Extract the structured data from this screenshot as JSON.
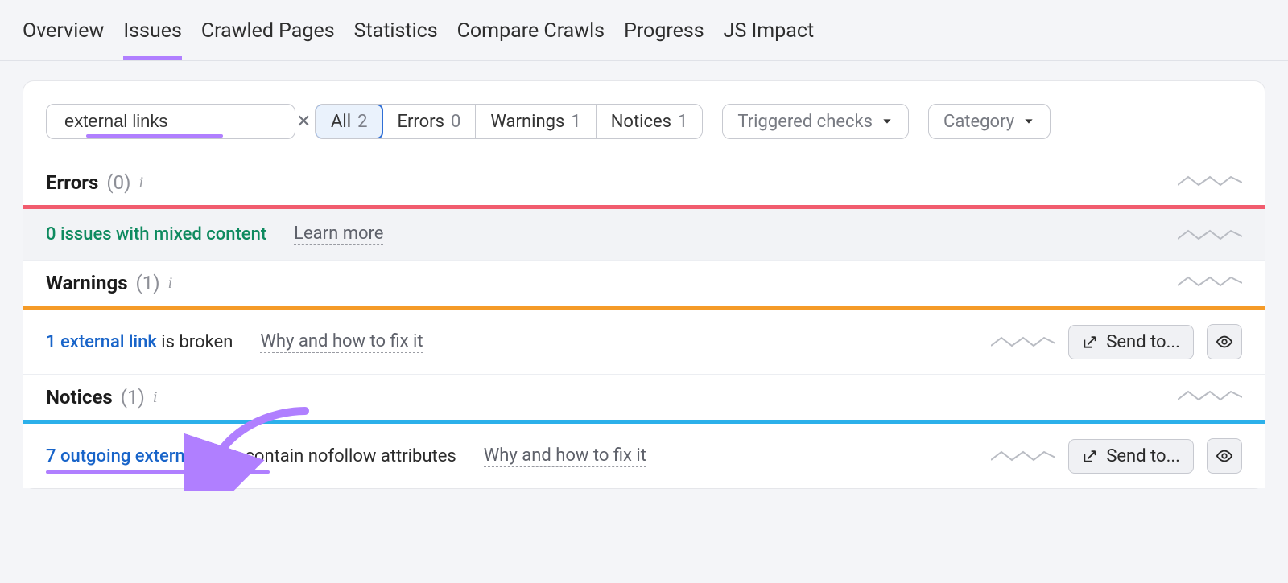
{
  "tabs": {
    "overview": "Overview",
    "issues": "Issues",
    "crawled": "Crawled Pages",
    "statistics": "Statistics",
    "compare": "Compare Crawls",
    "progress": "Progress",
    "jsimpact": "JS Impact"
  },
  "search": {
    "value": "external links"
  },
  "filters": {
    "all_label": "All",
    "all_count": "2",
    "errors_label": "Errors",
    "errors_count": "0",
    "warnings_label": "Warnings",
    "warnings_count": "1",
    "notices_label": "Notices",
    "notices_count": "1"
  },
  "dropdowns": {
    "triggered": "Triggered checks",
    "category": "Category"
  },
  "sections": {
    "errors_title": "Errors",
    "errors_count": "(0)",
    "warnings_title": "Warnings",
    "warnings_count": "(1)",
    "notices_title": "Notices",
    "notices_count": "(1)"
  },
  "rows": {
    "mixed_content": "0 issues with mixed content",
    "learn_more": "Learn more",
    "broken_link_a": "1 external link",
    "broken_link_b": " is broken",
    "why_fix": "Why and how to fix it",
    "nofollow_a": "7 outgoing external links",
    "nofollow_b": " contain nofollow attributes"
  },
  "buttons": {
    "send_to": "Send to..."
  }
}
